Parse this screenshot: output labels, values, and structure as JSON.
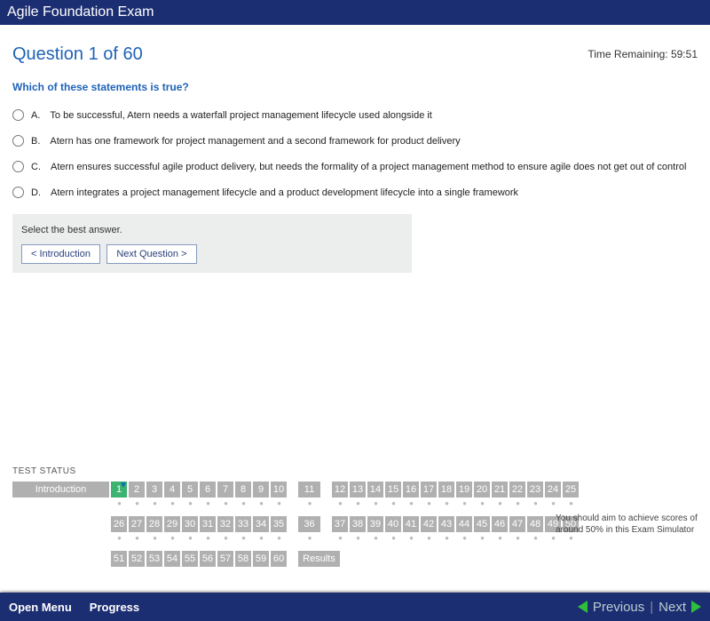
{
  "header": {
    "title": "Agile Foundation Exam"
  },
  "timer": {
    "label": "Time Remaining: 59:51"
  },
  "question": {
    "number_label": "Question 1 of 60",
    "text": "Which of these statements is true?",
    "answers": {
      "a": {
        "letter": "A.",
        "text": "To be successful, Atern needs a waterfall project management lifecycle used alongside it"
      },
      "b": {
        "letter": "B.",
        "text": "Atern has one framework for project management and a second framework for product delivery"
      },
      "c": {
        "letter": "C.",
        "text": "Atern ensures successful agile product delivery, but needs the formality of a project management method to ensure agile does not get out of control"
      },
      "d": {
        "letter": "D.",
        "text": "Atern integrates a project management lifecycle and a product development lifecycle into a single framework"
      }
    }
  },
  "panel": {
    "hint": "Select the best answer.",
    "back_label": "< Introduction",
    "next_label": "Next Question >"
  },
  "status": {
    "label": "TEST STATUS",
    "intro": "Introduction",
    "results": "Results",
    "q": {
      "1": "1",
      "2": "2",
      "3": "3",
      "4": "4",
      "5": "5",
      "6": "6",
      "7": "7",
      "8": "8",
      "9": "9",
      "10": "10",
      "11": "11",
      "12": "12",
      "13": "13",
      "14": "14",
      "15": "15",
      "16": "16",
      "17": "17",
      "18": "18",
      "19": "19",
      "20": "20",
      "21": "21",
      "22": "22",
      "23": "23",
      "24": "24",
      "25": "25",
      "26": "26",
      "27": "27",
      "28": "28",
      "29": "29",
      "30": "30",
      "31": "31",
      "32": "32",
      "33": "33",
      "34": "34",
      "35": "35",
      "36": "36",
      "37": "37",
      "38": "38",
      "39": "39",
      "40": "40",
      "41": "41",
      "42": "42",
      "43": "43",
      "44": "44",
      "45": "45",
      "46": "46",
      "47": "47",
      "48": "48",
      "49": "49",
      "50": "50",
      "51": "51",
      "52": "52",
      "53": "53",
      "54": "54",
      "55": "55",
      "56": "56",
      "57": "57",
      "58": "58",
      "59": "59",
      "60": "60"
    },
    "note": "You should aim to achieve scores of around 50% in this Exam Simulator"
  },
  "footer": {
    "open_menu": "Open Menu",
    "progress": "Progress",
    "prev": "Previous",
    "next": "Next"
  }
}
